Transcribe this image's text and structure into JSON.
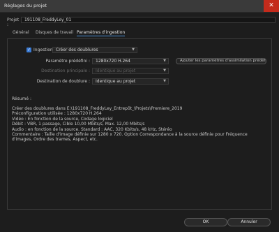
{
  "window": {
    "title": "Réglages du projet",
    "close_glyph": "✕"
  },
  "project": {
    "label": "Projet :",
    "value": "191108_FreddyLey_01"
  },
  "tabs": [
    {
      "label": "Général"
    },
    {
      "label": "Disques de travail"
    },
    {
      "label": "Paramètres d'ingestion"
    }
  ],
  "ingest": {
    "checkbox_label": "Ingestion",
    "checked": true,
    "mode_value": "Créer des doublures",
    "preset_label": "Paramètre prédéfini :",
    "preset_value": "1280x720 H.264",
    "add_button": "Ajouter les paramètres d'assimilation prédéfini...",
    "primary_dest_label": "Destination principale :",
    "primary_dest_value": "Identique au projet",
    "proxy_dest_label": "Destination de doublure :",
    "proxy_dest_value": "Identique au projet"
  },
  "summary": {
    "title": "Résumé :",
    "lines": [
      "Créer des doublures dans E:\\191108_FreddyLey_Entrepôt_\\Projets\\Premiere_2019",
      "Préconfiguration utilisée : 1280x720 H.264",
      "Vidéo : En fonction de la source, Codage logiciel",
      "Débit : VBR, 1 passage, Cible 10,00 Mbits/s, Max. 12,00 Mbits/s",
      "Audio : en fonction de la source. Standard : AAC, 320 Kbits/s, 48 kHz, Stéréo",
      "Commentaire : Taille d'image définie sur 1280 x 720. Option Correspondance à la source définie pour Fréquence d'images, Ordre des trames, Aspect, etc."
    ]
  },
  "buttons": {
    "ok": "OK",
    "cancel": "Annuler"
  },
  "colors": {
    "accent": "#3a7bd5",
    "close": "#c42b1c",
    "tab_underline": "#4a90d9"
  }
}
